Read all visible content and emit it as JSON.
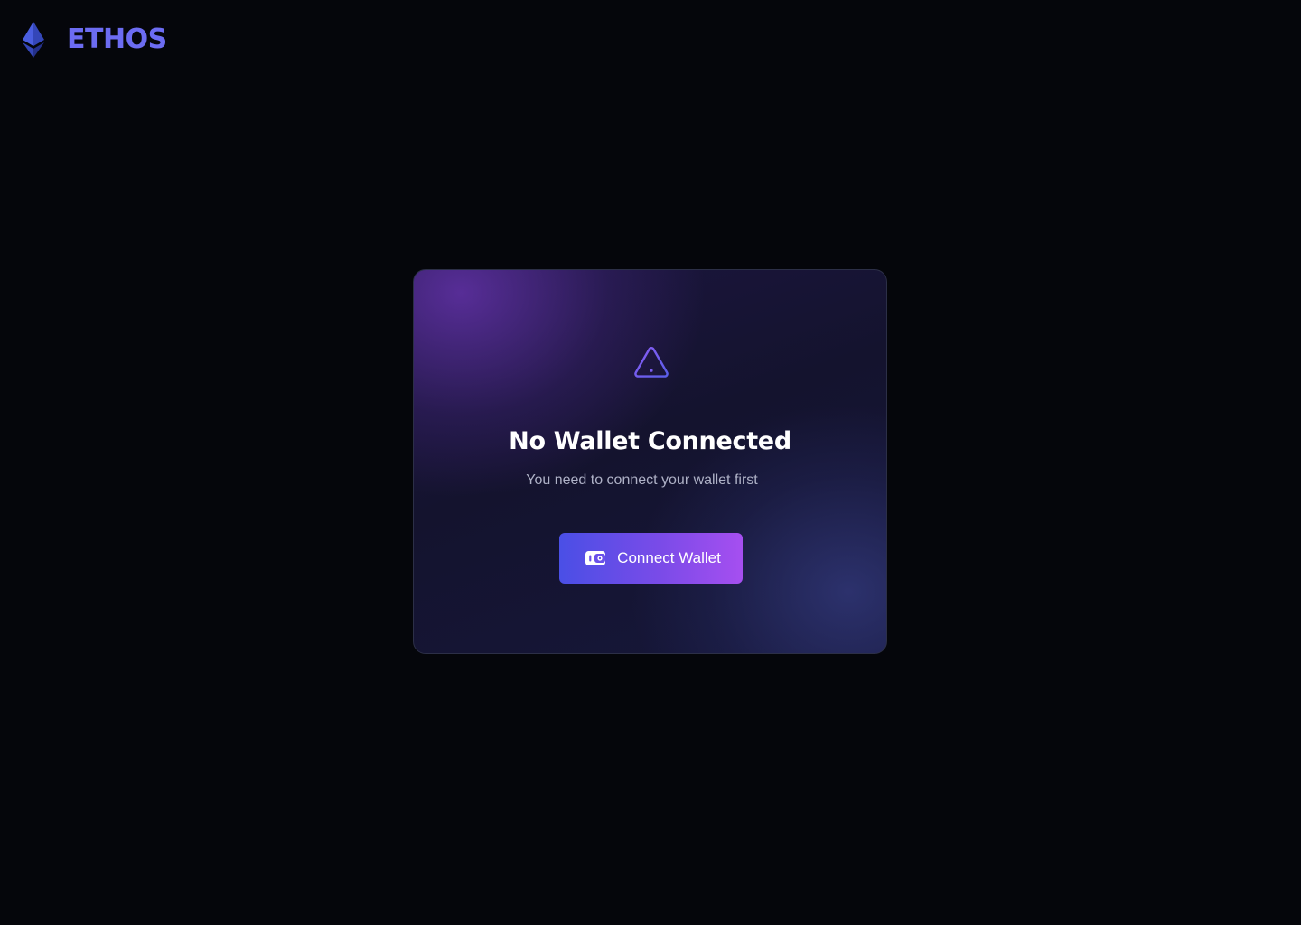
{
  "brand": {
    "name": "ETHOS",
    "logo_icon": "ethereum-diamond-icon",
    "color": "#6c6cf2"
  },
  "empty_state": {
    "icon": "warning-triangle-icon",
    "title": "No Wallet Connected",
    "subtitle": "You need to connect your wallet first",
    "button": {
      "label": "Connect Wallet",
      "icon": "wallet-icon"
    }
  },
  "colors": {
    "background": "#05060b",
    "accent_start": "#4a4fe6",
    "accent_end": "#a64ff0",
    "warning_icon": "#7a5cf0"
  }
}
